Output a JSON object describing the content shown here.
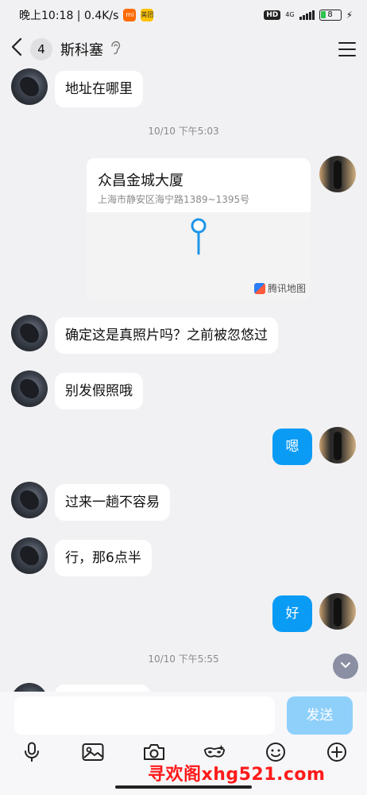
{
  "status_bar": {
    "time_label": "晚上10:18 | 0.4K/s",
    "app_badges": [
      {
        "icon": "xiaomi-icon",
        "label": "mi",
        "color": "#ff6a00"
      },
      {
        "icon": "meituan-icon",
        "label": "美团",
        "color": "#ffc300"
      }
    ],
    "hd_label": "HD",
    "network_label": "4G",
    "battery_level": "8"
  },
  "nav": {
    "unread_count": "4",
    "title": "斯科塞",
    "earpiece_icon": "ear-icon"
  },
  "messages": [
    {
      "from": "other",
      "text": "地址在哪里"
    },
    {
      "type": "timestamp",
      "text": "10/10 下午5:03"
    },
    {
      "from": "self",
      "type": "location",
      "name": "众昌金城大厦",
      "address": "上海市静安区海宁路1389~1395号",
      "map_brand": "腾讯地图"
    },
    {
      "from": "other",
      "text": "确定这是真照片吗？之前被忽悠过"
    },
    {
      "from": "other",
      "text": "别发假照哦"
    },
    {
      "from": "self",
      "text": "嗯"
    },
    {
      "from": "other",
      "text": "过来一趟不容易"
    },
    {
      "from": "other",
      "text": "行，那6点半"
    },
    {
      "from": "self",
      "text": "好"
    },
    {
      "type": "timestamp",
      "text": "10/10 下午5:55"
    }
  ],
  "composer": {
    "placeholder": "",
    "send_label": "发送",
    "accent_color": "#0a9bf5"
  },
  "toolbar_icons": [
    "microphone-icon",
    "image-icon",
    "camera-icon",
    "mask-icon",
    "emoji-icon",
    "plus-icon"
  ],
  "watermark": "寻欢阁xhg521.com"
}
